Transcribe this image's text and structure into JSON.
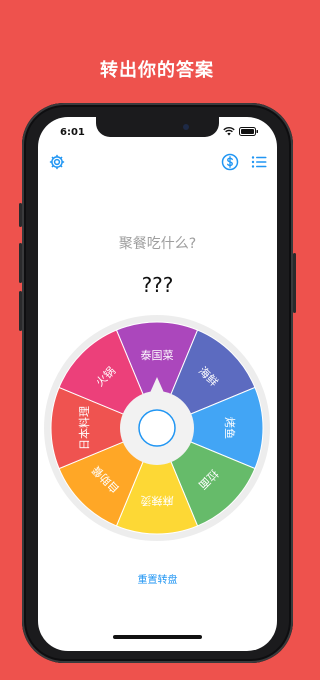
{
  "headline": "转出你的答案",
  "status_bar": {
    "time": "6:01"
  },
  "question": "聚餐吃什么?",
  "answer": "???",
  "reset_label": "重置转盘",
  "wheel": {
    "segments": [
      {
        "label": "泰国菜",
        "color": "#AB47BC"
      },
      {
        "label": "海鲜",
        "color": "#5C6BC0"
      },
      {
        "label": "烤鱼",
        "color": "#42A5F5"
      },
      {
        "label": "拉面",
        "color": "#66BB6A"
      },
      {
        "label": "麻辣烫",
        "color": "#FDD835"
      },
      {
        "label": "自助餐",
        "color": "#FFA726"
      },
      {
        "label": "日本料理",
        "color": "#EF5350"
      },
      {
        "label": "火锅",
        "color": "#EC407A"
      }
    ],
    "rim_color": "#EDEDED",
    "hub_color": "#F2F2F2",
    "button_ring_color": "#2196F3"
  },
  "icons": {
    "settings": "gear-icon",
    "currency": "dollar-circle-icon",
    "list": "list-icon"
  },
  "accent_color": "#2196F3",
  "background_color": "#EE524D"
}
